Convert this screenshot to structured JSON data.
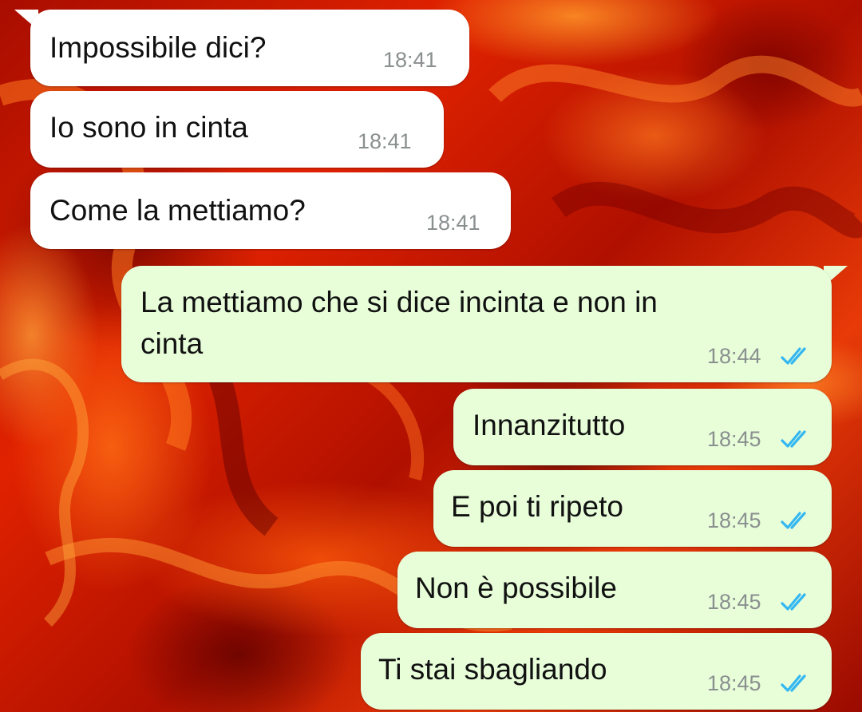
{
  "theme": {
    "incoming_bubble_color": "#ffffff",
    "outgoing_bubble_color": "#e7fed9",
    "read_tick_color": "#34b7f1",
    "time_color": "#8a8f8f",
    "wallpaper_dominant": "#c81800"
  },
  "messages": [
    {
      "direction": "incoming",
      "text": "Impossibile dici?",
      "time": "18:41"
    },
    {
      "direction": "incoming",
      "text": "Io sono in cinta",
      "time": "18:41"
    },
    {
      "direction": "incoming",
      "text": "Come la mettiamo?",
      "time": "18:41"
    },
    {
      "direction": "outgoing",
      "text_line1": "La mettiamo che si dice incinta e non in",
      "text_line2": "cinta",
      "time": "18:44",
      "status": "read",
      "status_icon": "double-check-icon"
    },
    {
      "direction": "outgoing",
      "text": "Innanzitutto",
      "time": "18:45",
      "status": "read",
      "status_icon": "double-check-icon"
    },
    {
      "direction": "outgoing",
      "text": "E poi ti ripeto",
      "time": "18:45",
      "status": "read",
      "status_icon": "double-check-icon"
    },
    {
      "direction": "outgoing",
      "text": "Non è possibile",
      "time": "18:45",
      "status": "read",
      "status_icon": "double-check-icon"
    },
    {
      "direction": "outgoing",
      "text": "Ti stai sbagliando",
      "time": "18:45",
      "status": "read",
      "status_icon": "double-check-icon"
    }
  ]
}
